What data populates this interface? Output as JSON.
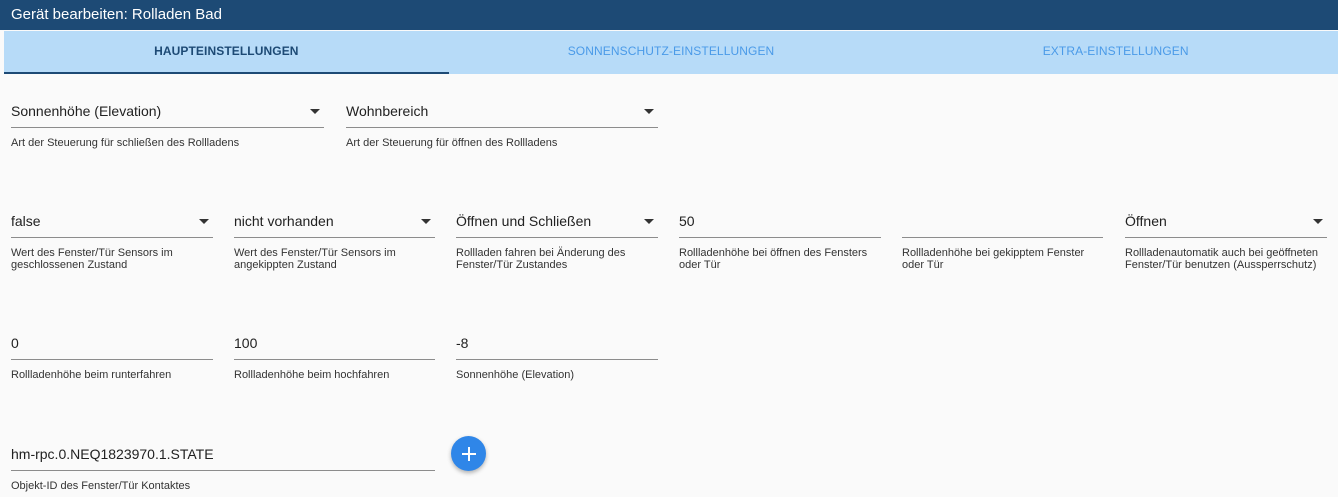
{
  "dialog": {
    "title": "Gerät bearbeiten: Rolladen Bad"
  },
  "tabs": [
    {
      "label": "HAUPTEINSTELLUNGEN",
      "active": true
    },
    {
      "label": "SONNENSCHUTZ-EINSTELLUNGEN",
      "active": false
    },
    {
      "label": "EXTRA-EINSTELLUNGEN",
      "active": false
    }
  ],
  "fields": {
    "close_control": {
      "value": "Sonnenhöhe (Elevation)",
      "help": "Art der Steuerung für schließen des Rollladens",
      "type": "select"
    },
    "open_control": {
      "value": "Wohnbereich",
      "help": "Art der Steuerung für öffnen des Rollladens",
      "type": "select"
    },
    "sensor_closed": {
      "value": "false",
      "help": "Wert des Fenster/Tür Sensors im geschlossenen Zustand",
      "type": "select"
    },
    "sensor_tilted": {
      "value": "nicht vorhanden",
      "help": "Wert des Fenster/Tür Sensors im angekippten Zustand",
      "type": "select"
    },
    "move_on_change": {
      "value": "Öffnen und Schließen",
      "help": "Rollladen fahren bei Änderung des Fenster/Tür Zustandes",
      "type": "select"
    },
    "height_window_open": {
      "value": "50",
      "help": "Rollladenhöhe bei öffnen des Fensters oder Tür",
      "type": "input"
    },
    "height_window_tilted": {
      "value": "",
      "help": "Rollladenhöhe bei gekipptem Fenster oder Tür",
      "type": "input"
    },
    "lockout_protection": {
      "value": "Öffnen",
      "help": "Rollladenautomatik auch bei geöffneten Fenster/Tür benutzen (Aussperrschutz)",
      "type": "select"
    },
    "height_down": {
      "value": "0",
      "help": "Rollladenhöhe beim runterfahren",
      "type": "input"
    },
    "height_up": {
      "value": "100",
      "help": "Rollladenhöhe beim hochfahren",
      "type": "input"
    },
    "sun_elevation": {
      "value": "-8",
      "help": "Sonnenhöhe (Elevation)",
      "type": "input"
    },
    "object_id": {
      "value": "hm-rpc.0.NEQ1823970.1.STATE",
      "help": "Objekt-ID des Fenster/Tür Kontaktes",
      "type": "input"
    }
  },
  "add_button": {
    "icon": "plus-icon",
    "color": "#2f86e8"
  },
  "colors": {
    "titlebar": "#1d4a75",
    "tabbar": "#b7dbf8",
    "tab_inactive": "#4a9ae8",
    "tab_active": "#1d4a75"
  }
}
